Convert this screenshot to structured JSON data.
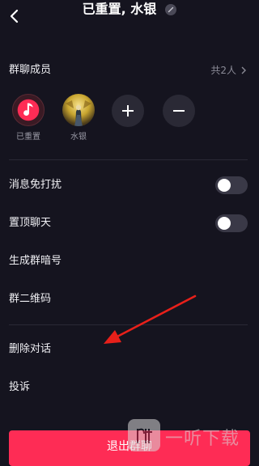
{
  "header": {
    "title": "已重置, 水银"
  },
  "members": {
    "label": "群聊成员",
    "count_text": "共2人",
    "list": [
      {
        "name": "已重置"
      },
      {
        "name": "水银"
      }
    ]
  },
  "options": {
    "mute": {
      "label": "消息免打扰",
      "enabled": false
    },
    "pin": {
      "label": "置顶聊天",
      "enabled": false
    },
    "code": {
      "label": "生成群暗号"
    },
    "qr": {
      "label": "群二维码"
    },
    "delete": {
      "label": "删除对话"
    },
    "report": {
      "label": "投诉"
    }
  },
  "exit_button": {
    "label": "退出群聊"
  },
  "watermark": {
    "text": "一听下载"
  },
  "colors": {
    "background": "#15141f",
    "accent": "#fe2c55",
    "annotation": "#e8201a"
  }
}
